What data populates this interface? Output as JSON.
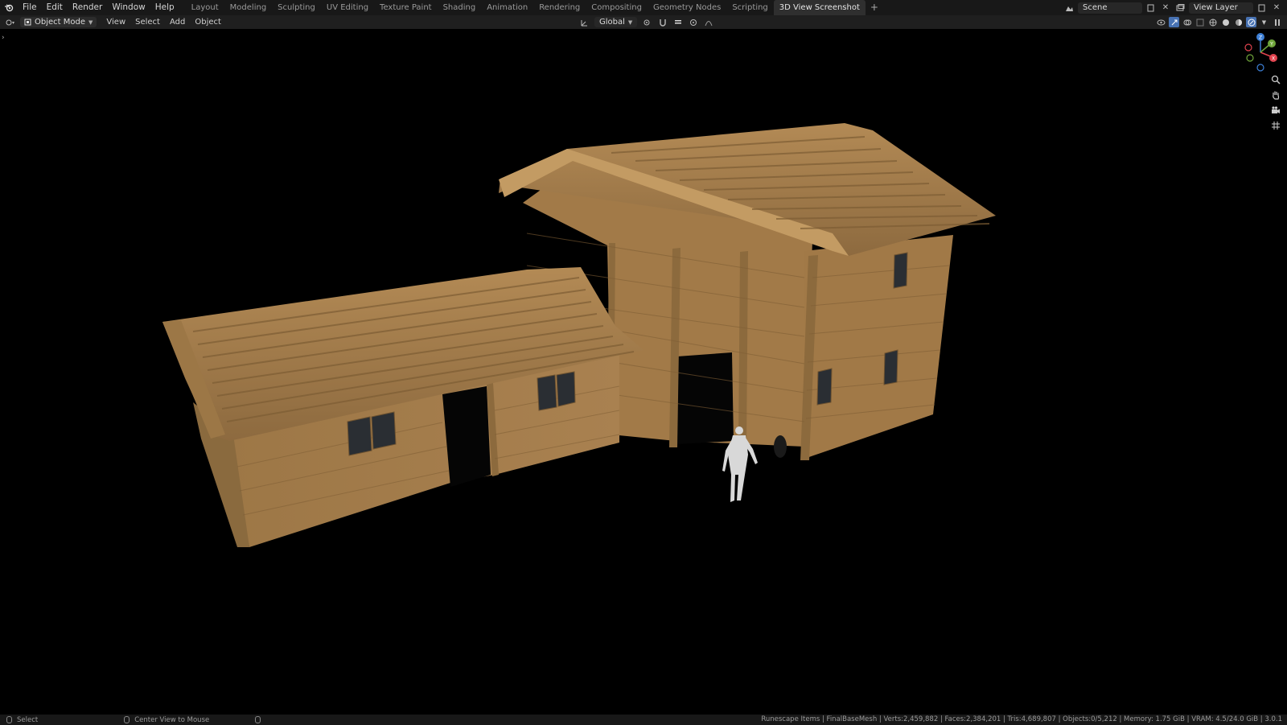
{
  "topbar": {
    "menus": [
      "File",
      "Edit",
      "Render",
      "Window",
      "Help"
    ],
    "workspaces": [
      {
        "label": "Layout",
        "active": false
      },
      {
        "label": "Modeling",
        "active": false
      },
      {
        "label": "Sculpting",
        "active": false
      },
      {
        "label": "UV Editing",
        "active": false
      },
      {
        "label": "Texture Paint",
        "active": false
      },
      {
        "label": "Shading",
        "active": false
      },
      {
        "label": "Animation",
        "active": false
      },
      {
        "label": "Rendering",
        "active": false
      },
      {
        "label": "Compositing",
        "active": false
      },
      {
        "label": "Geometry Nodes",
        "active": false
      },
      {
        "label": "Scripting",
        "active": false
      },
      {
        "label": "3D View Screenshot",
        "active": true
      }
    ],
    "add_workspace": "+",
    "scene_name": "Scene",
    "view_layer_name": "View Layer"
  },
  "header": {
    "mode": "Object Mode",
    "menus": [
      "View",
      "Select",
      "Add",
      "Object"
    ],
    "transform_orientation": "Global"
  },
  "viewport": {
    "gizmo_axes": [
      "Z",
      "Y",
      "X"
    ],
    "colors": {
      "x_axis": "#e0434e",
      "y_axis": "#6fa53b",
      "z_axis": "#3d7fd6",
      "wood": "#a57c4b"
    }
  },
  "statusbar": {
    "select_label": "Select",
    "center_label": "Center View to Mouse",
    "stats": "Runescape Items | FinalBaseMesh | Verts:2,459,882 | Faces:2,384,201 | Tris:4,689,807 | Objects:0/5,212 | Memory: 1.75 GiB | VRAM: 4.5/24.0 GiB | 3.0.1"
  }
}
